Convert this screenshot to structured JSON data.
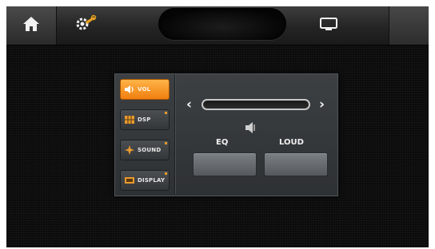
{
  "topbar": {
    "home_icon": "home-icon",
    "settings_icon": "gear-wrench-icon",
    "screen_icon": "screen-icon",
    "center_display": ""
  },
  "audio_menu": {
    "items": [
      {
        "label": "VOL",
        "icon": "speaker-icon",
        "active": true
      },
      {
        "label": "DSP",
        "icon": "grid-icon",
        "active": false
      },
      {
        "label": "SOUND",
        "icon": "star-icon",
        "active": false
      },
      {
        "label": "DISPLAY",
        "icon": "display-icon",
        "active": false
      }
    ]
  },
  "volume": {
    "left_arrow": "‹",
    "right_arrow": "›",
    "level": 0
  },
  "controls": {
    "eq_label": "EQ",
    "loud_label": "LOUD"
  },
  "colors": {
    "active_orange": "#f5901e",
    "panel_bg": "#34383a"
  }
}
